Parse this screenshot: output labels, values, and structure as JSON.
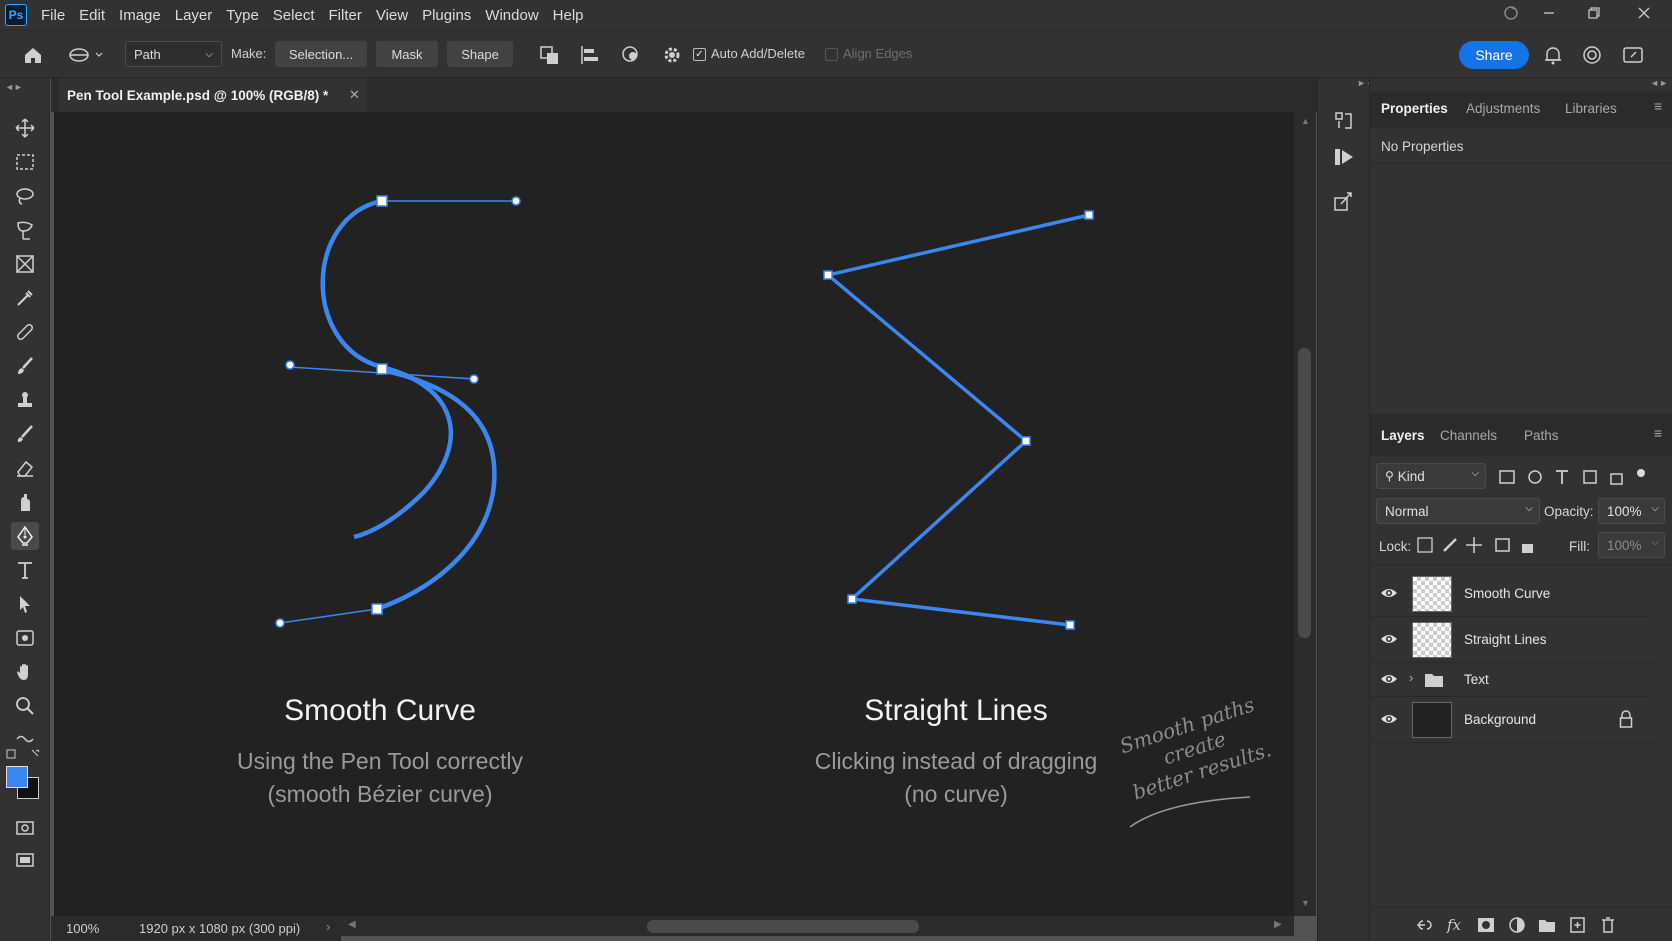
{
  "app": {
    "logo_text": "Ps"
  },
  "menu": [
    "File",
    "Edit",
    "Image",
    "Layer",
    "Type",
    "Select",
    "Filter",
    "View",
    "Plugins",
    "Window",
    "Help"
  ],
  "options": {
    "mode": "Path",
    "make_label": "Make:",
    "selection_button": "Selection...",
    "mask_button": "Mask",
    "shape_button": "Shape",
    "auto_add_delete_label": "Auto Add/Delete",
    "auto_add_delete_checked": true,
    "align_edges_label": "Align Edges",
    "align_edges_checked": false,
    "share_button": "Share"
  },
  "document": {
    "tab_title": "Pen Tool Example.psd @ 100% (RGB/8) *",
    "zoom": "100%",
    "dimensions": "1920 px x 1080 px (300 ppi)"
  },
  "canvas": {
    "left_title": "Smooth Curve",
    "left_caption_line1": "Using the Pen Tool correctly",
    "left_caption_line2": "(smooth Bézier curve)",
    "right_title": "Straight Lines",
    "right_caption_line1": "Clicking instead of dragging",
    "right_caption_line2": "(no curve)",
    "note_line1": "Smooth paths",
    "note_line2": "create",
    "note_line3": "better results.",
    "path_color": "#3b86ef"
  },
  "properties_panel": {
    "tabs": [
      "Properties",
      "Adjustments",
      "Libraries"
    ],
    "active_tab": "Properties",
    "content": "No Properties"
  },
  "layers_panel": {
    "tabs": [
      "Layers",
      "Channels",
      "Paths"
    ],
    "active_tab": "Layers",
    "filter_kind": "Kind",
    "blend_mode": "Normal",
    "opacity_label": "Opacity:",
    "opacity_value": "100%",
    "lock_label": "Lock:",
    "fill_label": "Fill:",
    "fill_value": "100%",
    "layers": [
      {
        "name": "Smooth Curve",
        "visible": true,
        "type": "pixel"
      },
      {
        "name": "Straight Lines",
        "visible": true,
        "type": "pixel"
      },
      {
        "name": "Text",
        "visible": true,
        "type": "group"
      },
      {
        "name": "Background",
        "visible": true,
        "type": "background",
        "locked": true
      }
    ]
  },
  "colors": {
    "foreground": "#3b86ef",
    "background": "#111111",
    "accent": "#1473e6"
  }
}
